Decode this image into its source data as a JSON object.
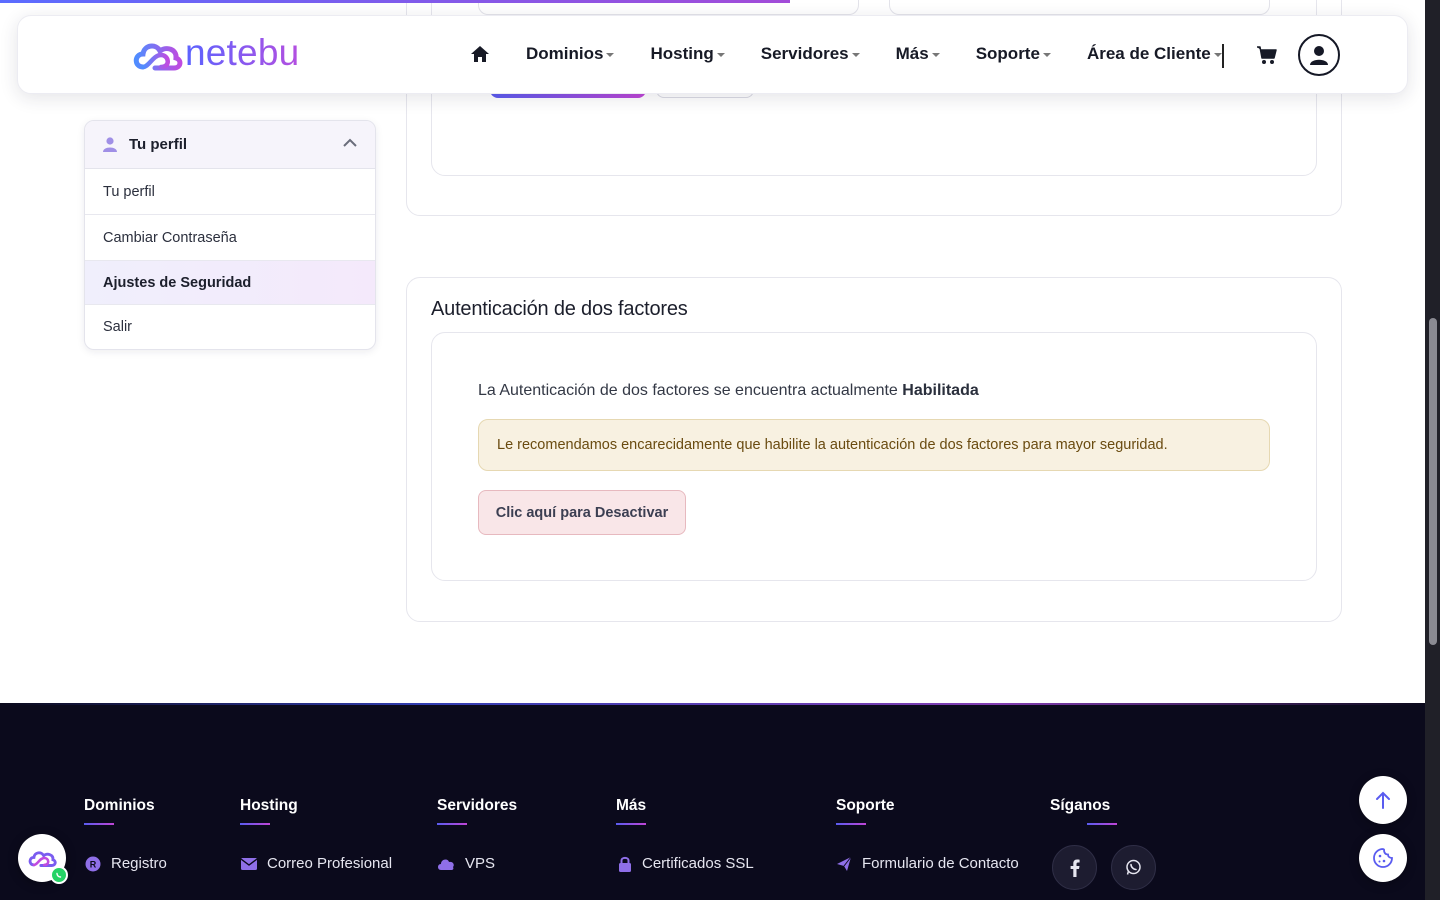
{
  "header": {
    "logo_text": "netebu",
    "nav": [
      {
        "label": "Dominios"
      },
      {
        "label": "Hosting"
      },
      {
        "label": "Servidores"
      },
      {
        "label": "Más"
      },
      {
        "label": "Soporte"
      },
      {
        "label": "Área de Cliente"
      }
    ]
  },
  "sidebar": {
    "title": "Tu perfil",
    "items": [
      {
        "label": "Tu perfil"
      },
      {
        "label": "Cambiar Contraseña"
      },
      {
        "label": "Ajustes de Seguridad",
        "active": true
      },
      {
        "label": "Salir"
      }
    ]
  },
  "twofa": {
    "title": "Autenticación de dos factores",
    "status_prefix": "La Autenticación de dos factores se encuentra actualmente ",
    "status_value": "Habilitada",
    "alert": "Le recomendamos encarecidamente que habilite la autenticación de dos factores para mayor seguridad.",
    "deactivate_label": "Clic aquí para Desactivar"
  },
  "footer": {
    "columns": [
      {
        "heading": "Dominios",
        "link": "Registro",
        "icon": "registered-icon"
      },
      {
        "heading": "Hosting",
        "link": "Correo Profesional",
        "icon": "envelope-icon"
      },
      {
        "heading": "Servidores",
        "link": "VPS",
        "icon": "cloud-icon"
      },
      {
        "heading": "Más",
        "link": "Certificados SSL",
        "icon": "lock-icon"
      },
      {
        "heading": "Soporte",
        "link": "Formulario de Contacto",
        "icon": "paper-plane-icon"
      },
      {
        "heading": "Síganos"
      }
    ]
  },
  "colors": {
    "brand_start": "#5b63ff",
    "brand_end": "#b44fe0",
    "footer_bg": "#0b0a1c",
    "alert_bg": "#f8f1e1",
    "danger_bg": "#f9e6e8"
  }
}
